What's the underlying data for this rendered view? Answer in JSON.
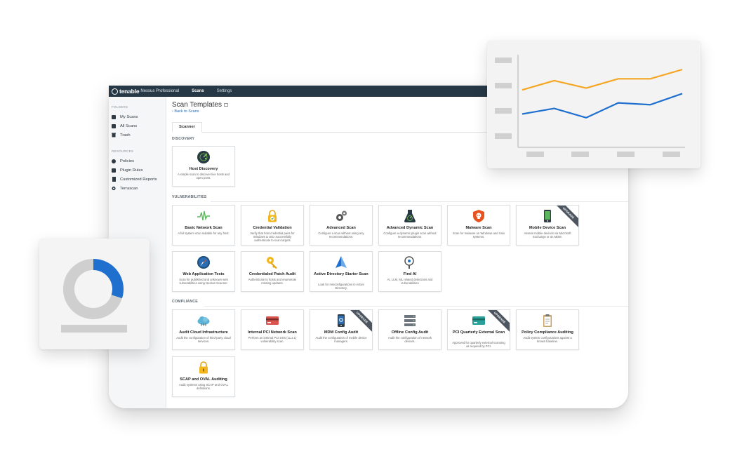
{
  "app": {
    "brand": "tenable",
    "product": "Nessus Professional",
    "nav": [
      "Scans",
      "Settings"
    ]
  },
  "sidebar": {
    "folders_heading": "FOLDERS",
    "folders": [
      "My Scans",
      "All Scans",
      "Trash"
    ],
    "resources_heading": "RESOURCES",
    "resources": [
      "Policies",
      "Plugin Rules",
      "Customized Reports",
      "Terrascan"
    ]
  },
  "page": {
    "title": "Scan Templates",
    "back_link": "‹ Back to Scans",
    "tab": "Scanner"
  },
  "sections": {
    "discovery": "DISCOVERY",
    "vulnerabilities": "VULNERABILITIES",
    "compliance": "COMPLIANCE"
  },
  "ribbon_text": "UPGRADE",
  "cards": [
    {
      "title": "Host Discovery",
      "desc": "A simple scan to discover live hosts and open ports."
    },
    {
      "title": "Basic Network Scan",
      "desc": "A full system scan suitable for any host."
    },
    {
      "title": "Credential Validation",
      "desc": "Verify that host credential pairs for Windows & Unix successfully authenticate to scan targets"
    },
    {
      "title": "Advanced Scan",
      "desc": "Configure a scan without using any recommendations."
    },
    {
      "title": "Advanced Dynamic Scan",
      "desc": "Configure a dynamic plugin scan without recommendations."
    },
    {
      "title": "Malware Scan",
      "desc": "Scan for malware on Windows and Unix systems."
    },
    {
      "title": "Mobile Device Scan",
      "desc": "Assess mobile devices via Microsoft Exchange or an MDM."
    },
    {
      "title": "Web Application Tests",
      "desc": "Scan for published and unknown web vulnerabilities using Nessus Scanner."
    },
    {
      "title": "Credentialed Patch Audit",
      "desc": "Authenticate to hosts and enumerate missing updates."
    },
    {
      "title": "Active Directory Starter Scan",
      "desc": "Look for misconfigurations in Active Directory."
    },
    {
      "title": "Find AI",
      "desc": "AI, LLM, ML related detections and vulnerabilities"
    },
    {
      "title": "Audit Cloud Infrastructure",
      "desc": "Audit the configuration of third-party cloud services."
    },
    {
      "title": "Internal PCI Network Scan",
      "desc": "Perform an internal PCI DSS (11.2.1) vulnerability scan."
    },
    {
      "title": "MDM Config Audit",
      "desc": "Audit the configuration of mobile device managers."
    },
    {
      "title": "Offline Config Audit",
      "desc": "Audit the configuration of network devices."
    },
    {
      "title": "PCI Quarterly External Scan",
      "desc": "Approved for quarterly external scanning as required by PCI."
    },
    {
      "title": "Policy Compliance Auditing",
      "desc": "Audit system configurations against a known baseline."
    },
    {
      "title": "SCAP and OVAL Auditing",
      "desc": "Audit systems using SCAP and OVAL definitions."
    }
  ],
  "colors": {
    "topbar": "#263846",
    "chart_orange": "#f5a623",
    "chart_blue": "#1f6fcf",
    "donut_blue": "#1f6fcf",
    "donut_gray": "#cfcfcf"
  },
  "chart_data": [
    {
      "type": "line",
      "x": [
        1,
        2,
        3,
        4,
        5,
        6
      ],
      "series": [
        {
          "values": [
            3.1,
            3.6,
            3.2,
            3.7,
            3.7,
            4.2
          ]
        },
        {
          "values": [
            1.8,
            2.1,
            1.6,
            2.4,
            2.3,
            2.9
          ]
        }
      ],
      "ylim": [
        0,
        5
      ],
      "grid": false
    },
    {
      "type": "pie",
      "values": [
        30,
        70
      ],
      "donut": true
    }
  ]
}
